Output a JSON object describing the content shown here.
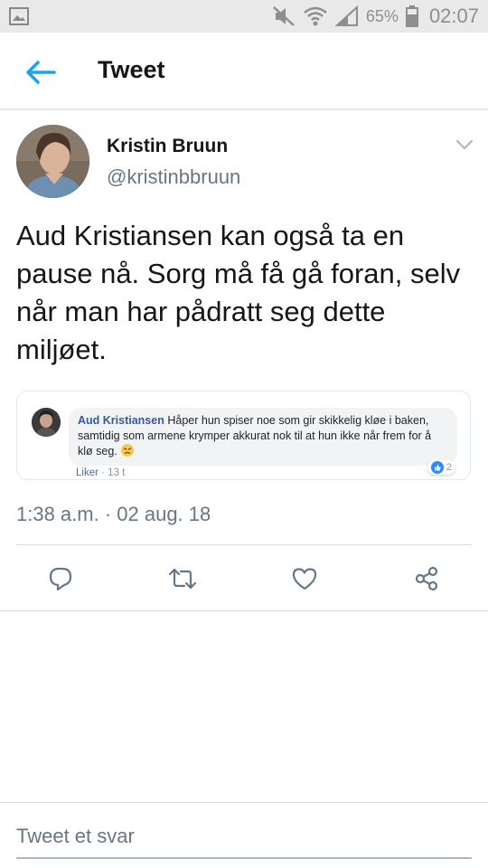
{
  "status_bar": {
    "battery_percent": "65%",
    "time": "02:07",
    "icons": [
      "gallery-icon",
      "mute-icon",
      "wifi-icon",
      "signal-icon",
      "battery-icon"
    ]
  },
  "header": {
    "title": "Tweet",
    "back_icon": "arrow-left-icon"
  },
  "tweet": {
    "author_name": "Kristin Bruun",
    "author_handle": "@kristinbbruun",
    "text": "Aud Kristiansen kan også ta en pause nå. Sorg må få gå foran, selv når man har pådratt seg dette miljøet.",
    "timestamp": "1:38 a.m. · 02 aug. 18",
    "embedded_comment": {
      "name": "Aud Kristiansen",
      "text": "Håper hun spiser noe som gir skikkelig kløe i baken, samtidig som armene krymper akkurat nok til at hun ikke når frem for å klø seg.",
      "like_label": "Liker",
      "age": "13 t",
      "reaction_count": "2"
    }
  },
  "actions": [
    "reply-icon",
    "retweet-icon",
    "like-icon",
    "share-icon"
  ],
  "reply_box": {
    "placeholder": "Tweet et svar"
  },
  "colors": {
    "accent": "#1da1f2",
    "icon_gray": "#657786",
    "facebook_name": "#385898"
  }
}
